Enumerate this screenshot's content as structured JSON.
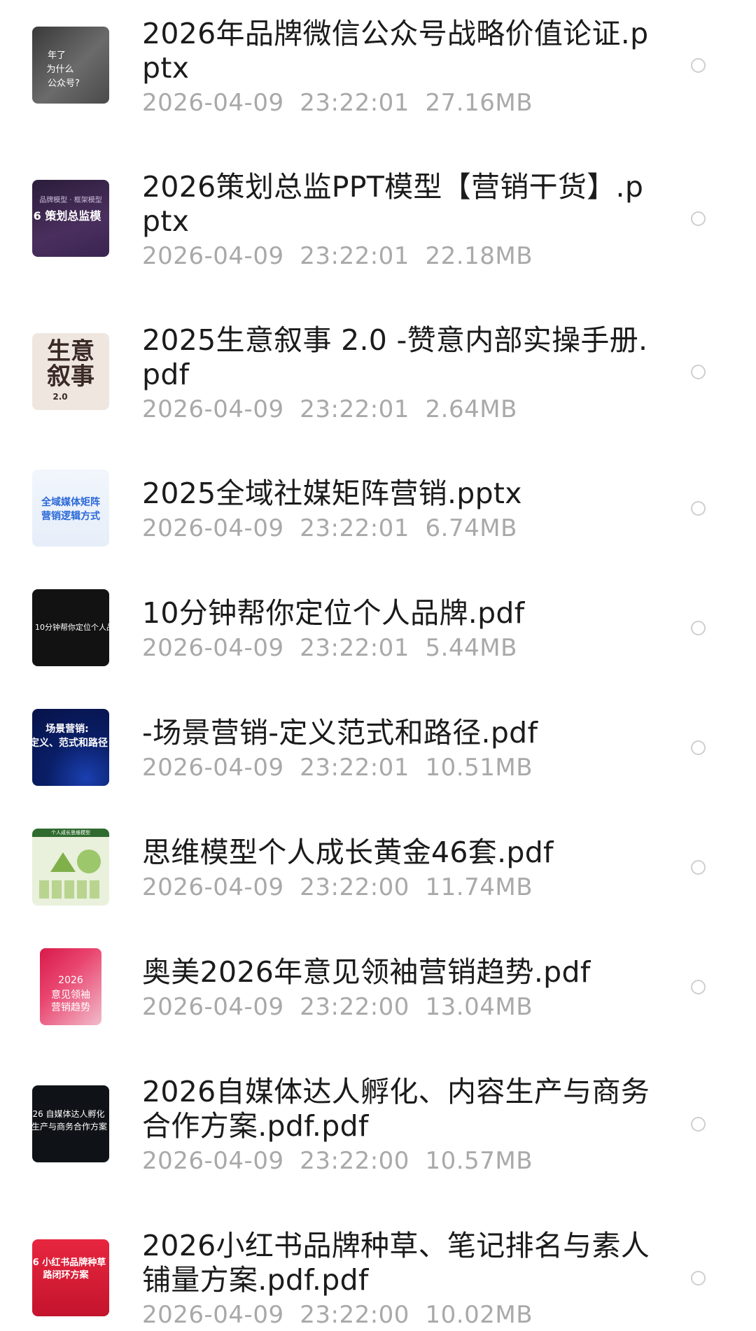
{
  "files": [
    {
      "title": "2026年品牌微信公众号战略价值论证.pptx",
      "date": "2026-04-09",
      "time": "23:22:01",
      "size": "27.16MB",
      "thumb_text": [
        "年了",
        "为什么",
        "公众号?"
      ],
      "thumb_icon": "ppt-thumbnail-icon"
    },
    {
      "title": "2026策划总监PPT模型【营销干货】.pptx",
      "date": "2026-04-09",
      "time": "23:22:01",
      "size": "22.18MB",
      "thumb_text": [
        "品牌模型 · 框架模型",
        "6 策划总监模"
      ],
      "thumb_icon": "ppt-thumbnail-icon"
    },
    {
      "title": "2025生意叙事 2.0 -赞意内部实操手册.pdf",
      "date": "2026-04-09",
      "time": "23:22:01",
      "size": "2.64MB",
      "thumb_text": [
        "生意",
        "叙事",
        "2.0"
      ],
      "thumb_icon": "pdf-thumbnail-icon"
    },
    {
      "title": "2025全域社媒矩阵营销.pptx",
      "date": "2026-04-09",
      "time": "23:22:01",
      "size": "6.74MB",
      "thumb_text": [
        "全域媒体矩阵",
        "营销逻辑方式"
      ],
      "thumb_icon": "ppt-thumbnail-icon"
    },
    {
      "title": "10分钟帮你定位个人品牌.pdf",
      "date": "2026-04-09",
      "time": "23:22:01",
      "size": "5.44MB",
      "thumb_text": [
        "10分钟帮你定位个人品"
      ],
      "thumb_icon": "pdf-thumbnail-icon"
    },
    {
      "title": "-场景营销-定义范式和路径.pdf",
      "date": "2026-04-09",
      "time": "23:22:01",
      "size": "10.51MB",
      "thumb_text": [
        "场景营销:",
        "定义、范式和路径"
      ],
      "thumb_icon": "pdf-thumbnail-icon"
    },
    {
      "title": "思维模型个人成长黄金46套.pdf",
      "date": "2026-04-09",
      "time": "23:22:00",
      "size": "11.74MB",
      "thumb_text": [
        "个人成长思维模型"
      ],
      "thumb_icon": "pdf-thumbnail-icon"
    },
    {
      "title": "奥美2026年意见领袖营销趋势.pdf",
      "date": "2026-04-09",
      "time": "23:22:00",
      "size": "13.04MB",
      "thumb_text": [
        "2026",
        "意见领袖",
        "营销趋势"
      ],
      "thumb_icon": "pdf-thumbnail-icon"
    },
    {
      "title": "2026自媒体达人孵化、内容生产与商务合作方案.pdf.pdf",
      "date": "2026-04-09",
      "time": "23:22:00",
      "size": "10.57MB",
      "thumb_text": [
        "26 自媒体达人孵化",
        "生产与商务合作方案"
      ],
      "thumb_icon": "pdf-thumbnail-icon"
    },
    {
      "title": "2026小红书品牌种草、笔记排名与素人铺量方案.pdf.pdf",
      "date": "2026-04-09",
      "time": "23:22:00",
      "size": "10.02MB",
      "thumb_text": [
        "6 小红书品牌种草",
        "路闭环方案"
      ],
      "thumb_icon": "pdf-thumbnail-icon"
    }
  ]
}
